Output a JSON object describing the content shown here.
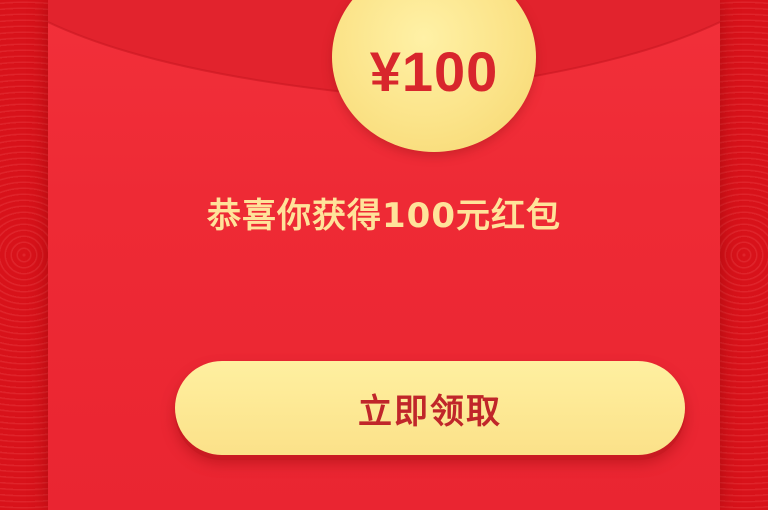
{
  "envelope": {
    "amount_label": "¥100",
    "message": "恭喜你获得100元红包",
    "claim_button_label": "立即领取"
  },
  "colors": {
    "background_red": "#e0141b",
    "envelope_red": "#ee2a35",
    "gold": "#fbe388",
    "text_red": "#d8262c",
    "message_gold": "#ffe39a"
  }
}
